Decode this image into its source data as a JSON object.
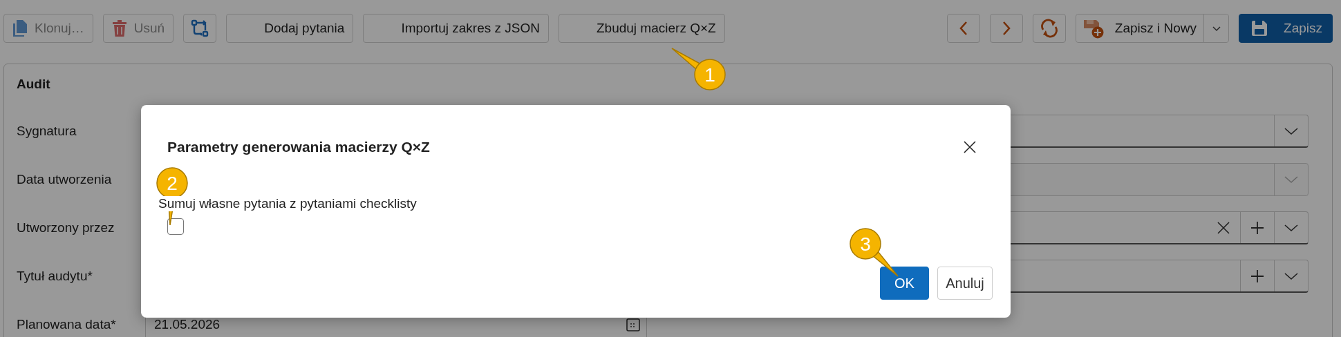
{
  "toolbar": {
    "left": [
      {
        "kind": "clone",
        "label": "Klonuj…",
        "disabled": true
      },
      {
        "kind": "delete",
        "label": "Usuń",
        "disabled": true
      },
      {
        "kind": "swap",
        "disabled": false
      },
      {
        "kind": "plain",
        "label": "Dodaj pytania",
        "disabled": false
      },
      {
        "kind": "plain",
        "label": "Importuj zakres z JSON",
        "disabled": false
      },
      {
        "kind": "plain",
        "label": "Zbuduj macierz Q×Z",
        "disabled": false
      }
    ],
    "right": [
      {
        "kind": "prev"
      },
      {
        "kind": "next"
      },
      {
        "kind": "refresh"
      },
      {
        "kind": "split",
        "label": "Zapisz i Nowy"
      },
      {
        "kind": "primary",
        "label": "Zapisz"
      }
    ]
  },
  "form": {
    "title": "Audit",
    "rows": [
      {
        "kind": "select",
        "label": "Sygnatura",
        "disabled": false,
        "clearable": false,
        "addable": false
      },
      {
        "kind": "select",
        "label": "Data utworzenia",
        "disabled": true,
        "clearable": false,
        "addable": false
      },
      {
        "kind": "select",
        "label": "Utworzony przez",
        "disabled": false,
        "clearable": true,
        "addable": true
      },
      {
        "kind": "select",
        "label": "Tytuł audytu*",
        "disabled": false,
        "clearable": false,
        "addable": true
      },
      {
        "kind": "date",
        "label": "Planowana data*",
        "value": "21.05.2026"
      }
    ]
  },
  "dialog": {
    "title": "Parametry generowania macierzy Q×Z",
    "option": {
      "label": "Sumuj własne pytania z pytaniami checklisty",
      "checked": false
    },
    "buttons": [
      {
        "kind": "primary",
        "label": "OK"
      },
      {
        "kind": "secondary",
        "label": "Anuluj"
      }
    ]
  },
  "callouts": [
    "1",
    "2",
    "3"
  ]
}
